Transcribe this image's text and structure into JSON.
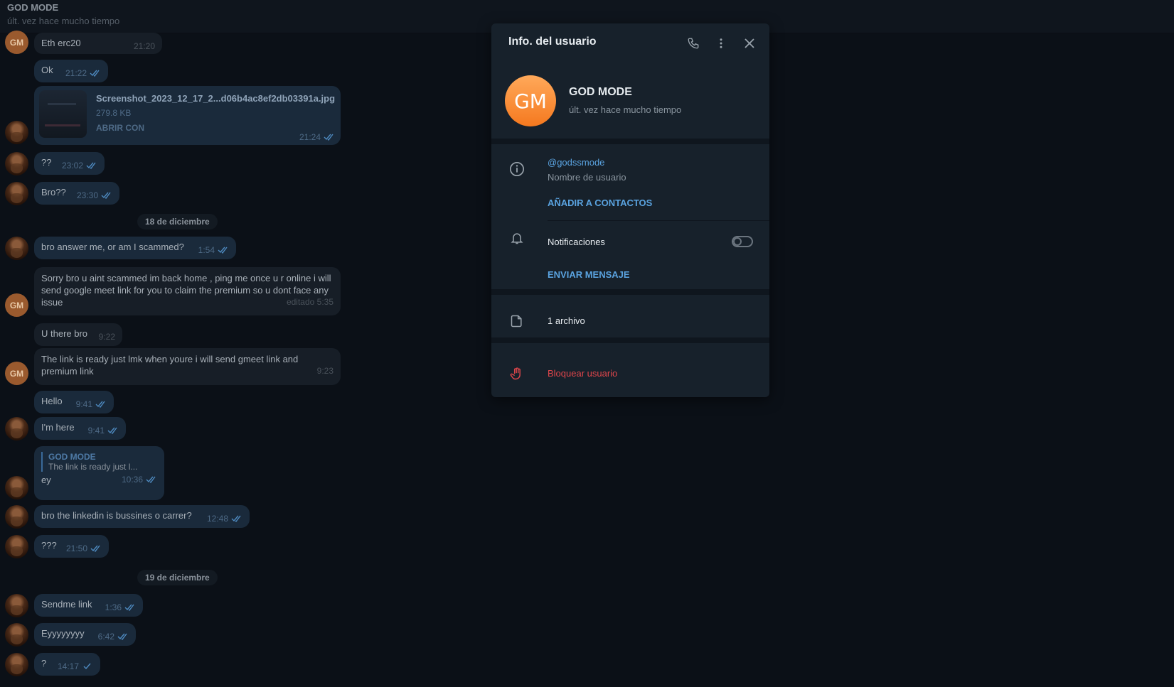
{
  "chat_header": {
    "name": "GOD MODE",
    "status": "últ. vez hace mucho tiempo"
  },
  "messages": {
    "m1": {
      "text": "Eth erc20",
      "time": "21:20"
    },
    "m2": {
      "text": "Ok",
      "time": "21:22"
    },
    "file": {
      "name": "Screenshot_2023_12_17_2...d06b4ac8ef2db03391a.jpg",
      "size": "279.8 KB",
      "action": "ABRIR CON",
      "time": "21:24"
    },
    "m3": {
      "text": "??",
      "time": "23:02"
    },
    "m4": {
      "text": "Bro??",
      "time": "23:30"
    },
    "date1": "18 de diciembre",
    "m5": {
      "text": "bro answer me, or am I scammed?",
      "time": "1:54"
    },
    "m6": {
      "text": "Sorry bro u aint scammed im back home , ping me once u r online i will send google meet link for you to claim the premium so u dont face any issue",
      "time": "editado 5:35"
    },
    "m7": {
      "text": "U there bro",
      "time": "9:22"
    },
    "m8": {
      "text": "The link is ready just lmk when youre i will send gmeet link and premium link",
      "time": "9:23"
    },
    "m9": {
      "text": "Hello",
      "time": "9:41"
    },
    "m10": {
      "text": "I'm here",
      "time": "9:41"
    },
    "m11": {
      "reply_name": "GOD MODE",
      "reply_text": "The link is ready just l...",
      "text": "ey",
      "time": "10:36"
    },
    "m12": {
      "text": "bro the linkedin is bussines o carrer?",
      "time": "12:48"
    },
    "m13": {
      "text": "???",
      "time": "21:50"
    },
    "date2": "19 de diciembre",
    "m14": {
      "text": "Sendme link",
      "time": "1:36"
    },
    "m15": {
      "text": "Eyyyyyyyy",
      "time": "6:42"
    },
    "m16": {
      "text": "?",
      "time": "14:17"
    }
  },
  "avatar_initials": "GM",
  "panel": {
    "title": "Info. del usuario",
    "avatar_initials": "GM",
    "name": "GOD MODE",
    "status": "últ. vez hace mucho tiempo",
    "username": "@godssmode",
    "username_label": "Nombre de usuario",
    "add_contacts": "AÑADIR A CONTACTOS",
    "notifications_label": "Notificaciones",
    "notifications_on": false,
    "send_message": "ENVIAR MENSAJE",
    "files": "1 archivo",
    "block": "Bloquear usuario"
  },
  "colors": {
    "accent": "#5aa3e0",
    "danger": "#e0464b",
    "avatar": "#f5791f",
    "outgoing": "#1a2a3b",
    "incoming": "#171e27"
  }
}
